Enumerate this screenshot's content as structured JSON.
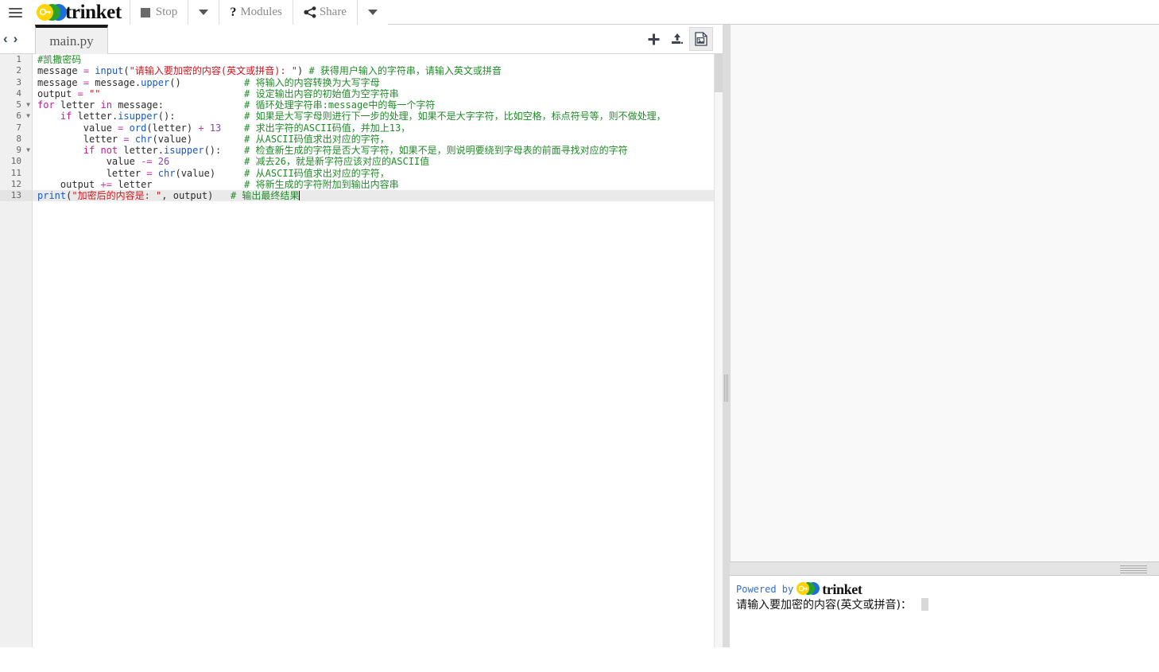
{
  "topbar": {
    "menu_icon": "hamburger-icon",
    "brand": "trinket",
    "buttons": [
      {
        "label": "Stop",
        "icon": "stop-square-icon"
      },
      {
        "label": "",
        "icon": "chevron-down-icon"
      },
      {
        "label": "Modules",
        "icon": "question-mark-icon"
      },
      {
        "label": "Share",
        "icon": "share-nodes-icon"
      },
      {
        "label": "",
        "icon": "chevron-down-icon"
      }
    ],
    "stop_label": "Stop",
    "modules_label": "Modules",
    "modules_prefix": "?",
    "share_label": "Share"
  },
  "editor": {
    "nav_back": "‹",
    "nav_forward": "›",
    "tab_name": "main.py",
    "tab_icons": [
      {
        "name": "add-file-icon",
        "glyph": "+"
      },
      {
        "name": "upload-file-icon",
        "glyph": "upload"
      },
      {
        "name": "image-file-icon",
        "glyph": "image",
        "active": true
      }
    ],
    "current_line": 13,
    "fold_lines": [
      5,
      6,
      9
    ],
    "line_numbers": [
      1,
      2,
      3,
      4,
      5,
      6,
      7,
      8,
      9,
      10,
      11,
      12,
      13
    ],
    "lines": [
      {
        "num": 1,
        "code": "#凯撒密码",
        "comment": ""
      },
      {
        "num": 2,
        "code": "message = input(\"请输入要加密的内容(英文或拼音): \")",
        "comment": "# 获得用户输入的字符串，请输入英文或拼音"
      },
      {
        "num": 3,
        "code": "message = message.upper()",
        "comment": "# 将输入的内容转换为大写字母"
      },
      {
        "num": 4,
        "code": "output = \"\"",
        "comment": "# 设定输出内容的初始值为空字符串"
      },
      {
        "num": 5,
        "code": "for letter in message:",
        "comment": "# 循环处理字符串:message中的每一个字符"
      },
      {
        "num": 6,
        "code": "    if letter.isupper():",
        "comment": "# 如果是大写字母则进行下一步的处理，如果不是大字字符，比如空格，标点符号等，则不做处理，"
      },
      {
        "num": 7,
        "code": "        value = ord(letter) + 13",
        "comment": "# 求出字符的ASCII码值，并加上13，"
      },
      {
        "num": 8,
        "code": "        letter = chr(value)",
        "comment": "# 从ASCII码值求出对应的字符，"
      },
      {
        "num": 9,
        "code": "        if not letter.isupper():",
        "comment": "# 检查新生成的字符是否大写字符，如果不是，则说明要绕到字母表的前面寻找对应的字符"
      },
      {
        "num": 10,
        "code": "            value -= 26",
        "comment": "# 减去26，就是新字符应该对应的ASCII值"
      },
      {
        "num": 11,
        "code": "            letter = chr(value)",
        "comment": "# 从ASCII码值求出对应的字符，"
      },
      {
        "num": 12,
        "code": "    output += letter",
        "comment": "# 将新生成的字符附加到输出内容串"
      },
      {
        "num": 13,
        "code": "print(\"加密后的内容是: \", output)",
        "comment": "# 输出最终结果"
      }
    ]
  },
  "console": {
    "powered_by": "Powered by",
    "brand": "trinket",
    "prompt": "请输入要加密的内容(英文或拼音)：",
    "input_value": ""
  },
  "colors": {
    "keyword": "#cc17a0",
    "builtin": "#1a57c4",
    "string": "#d4141b",
    "number": "#8642b8",
    "comment": "#1f8a27",
    "brand_blue": "#2f6fd0",
    "logo_yellow": "#ffd400",
    "logo_green": "#2aa22a",
    "logo_blue": "#1a6fdb"
  }
}
